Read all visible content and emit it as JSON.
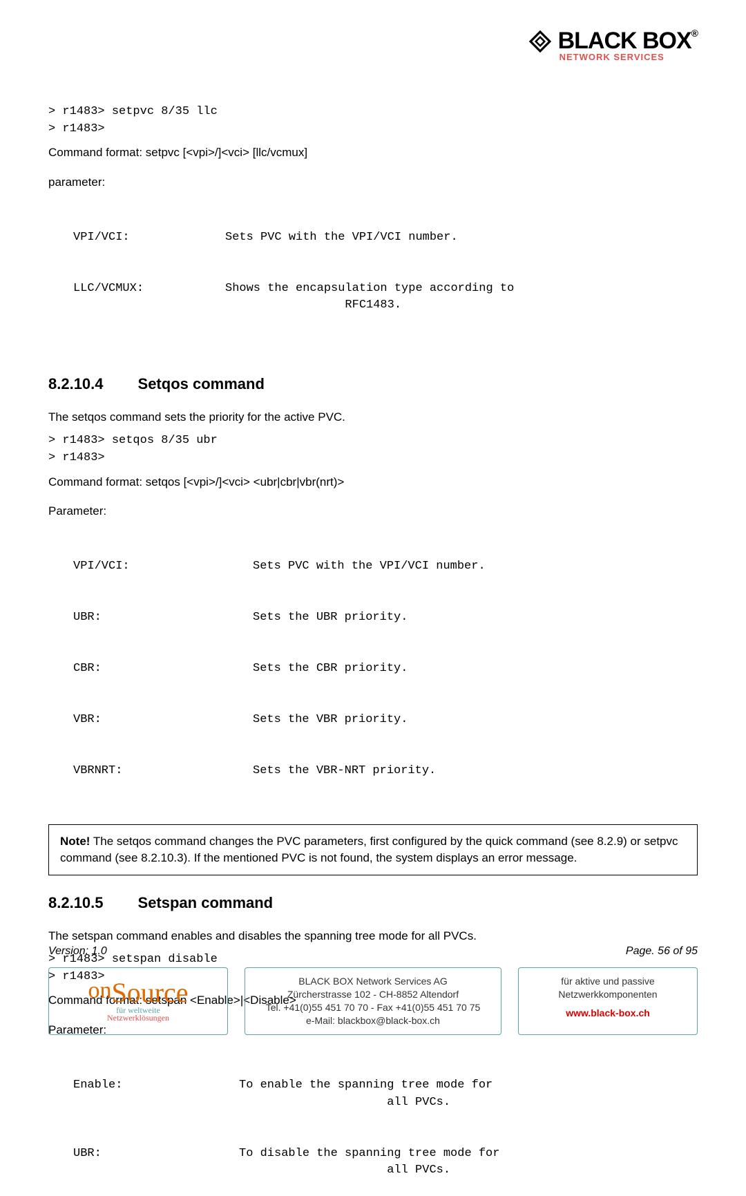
{
  "logo": {
    "main": "BLACK BOX",
    "reg": "®",
    "sub": "NETWORK SERVICES"
  },
  "topcode": "> r1483> setpvc 8/35 llc\n> r1483>",
  "fmt1": "Command format: setpvc [<vpi>/]<vci> [llc/vcmux]",
  "paramlabel1": "parameter:",
  "params1": [
    {
      "k": "VPI/VCI:",
      "v": "Sets PVC with the VPI/VCI number."
    },
    {
      "k": "LLC/VCMUX:",
      "v": "Shows the encapsulation type according to\n                 RFC1483."
    }
  ],
  "h1": {
    "num": "8.2.10.4",
    "title": "Setqos command"
  },
  "h1desc": "The setqos command sets the priority for the active PVC.",
  "h1code": "> r1483> setqos 8/35 ubr\n> r1483>",
  "fmt2": "Command format: setqos [<vpi>/]<vci> <ubr|cbr|vbr(nrt)>",
  "paramlabel2": "Parameter:",
  "params2": [
    {
      "k": "VPI/VCI:",
      "v": "Sets PVC with the VPI/VCI number."
    },
    {
      "k": "UBR:",
      "v": "Sets the UBR priority."
    },
    {
      "k": "CBR:",
      "v": "Sets the CBR priority."
    },
    {
      "k": "VBR:",
      "v": "Sets the VBR priority."
    },
    {
      "k": "VBRNRT:",
      "v": "Sets the VBR-NRT priority."
    }
  ],
  "note": {
    "lead": "Note!",
    "body": " The setqos command changes the PVC parameters, first configured by the quick command (see 8.2.9) or setpvc command (see 8.2.10.3). If the mentioned PVC is not found, the system displays an error message."
  },
  "h2": {
    "num": "8.2.10.5",
    "title": "Setspan command"
  },
  "h2desc": "The setspan command enables and disables the spanning tree mode for all PVCs.",
  "h2code": "> r1483> setspan disable\n> r1483>",
  "fmt3": "Command format: setspan <Enable>|<Disable>",
  "paramlabel3": "Parameter:",
  "params3": [
    {
      "k": "Enable:",
      "v": "To enable the spanning tree mode for\n                     all PVCs."
    },
    {
      "k": "UBR:",
      "v": "To disable the spanning tree mode for\n                     all PVCs."
    }
  ],
  "version": "Version: 1.0",
  "page": "Page. 56 of 95",
  "footer": {
    "onsource": {
      "on": "on",
      "source": "Source",
      "l1": "für weltweite",
      "l2": "Netzwerklösungen"
    },
    "mid": "BLACK BOX Network Services AG\nZürcherstrasse 102 - CH-8852 Altendorf\nTel. +41(0)55 451 70 70 - Fax +41(0)55 451 70 75\ne-Mail: blackbox@black-box.ch",
    "right": {
      "l1": "für aktive und passive",
      "l2": "Netzwerkkomponenten",
      "link": "www.black-box.ch"
    }
  }
}
